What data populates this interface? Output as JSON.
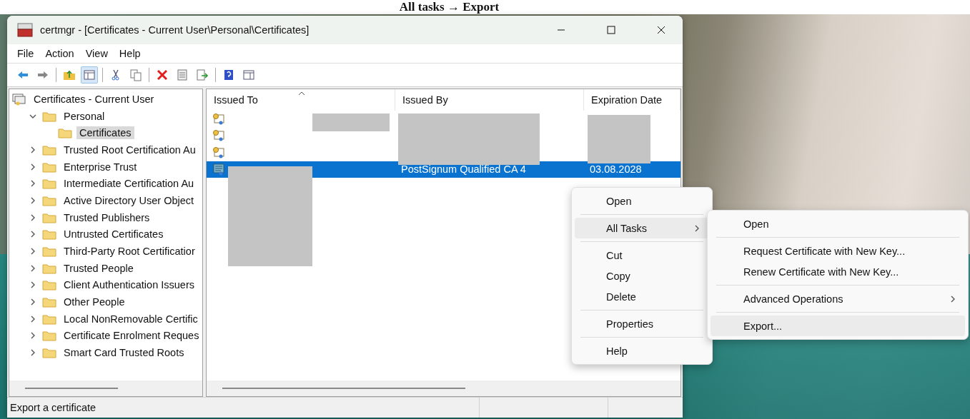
{
  "caption": "All tasks → Export",
  "window": {
    "title": "certmgr - [Certificates - Current User\\Personal\\Certificates]"
  },
  "menu_bar": [
    "File",
    "Action",
    "View",
    "Help"
  ],
  "tree": {
    "label": "Certificates - Current User",
    "selected": false,
    "children": [
      {
        "label": "Personal",
        "selected": false,
        "expanded": true,
        "children": [
          {
            "label": "Certificates",
            "selected": true
          }
        ]
      },
      {
        "label": "Trusted Root Certification Au",
        "selected": false,
        "expanded": false
      },
      {
        "label": "Enterprise Trust",
        "selected": false,
        "expanded": false
      },
      {
        "label": "Intermediate Certification Au",
        "selected": false,
        "expanded": false
      },
      {
        "label": "Active Directory User Object",
        "selected": false,
        "expanded": false
      },
      {
        "label": "Trusted Publishers",
        "selected": false,
        "expanded": false
      },
      {
        "label": "Untrusted Certificates",
        "selected": false,
        "expanded": false
      },
      {
        "label": "Third-Party Root Certificatior",
        "selected": false,
        "expanded": false
      },
      {
        "label": "Trusted People",
        "selected": false,
        "expanded": false
      },
      {
        "label": "Client Authentication Issuers",
        "selected": false,
        "expanded": false
      },
      {
        "label": "Other People",
        "selected": false,
        "expanded": false
      },
      {
        "label": "Local NonRemovable Certific",
        "selected": false,
        "expanded": false
      },
      {
        "label": "Certificate Enrolment Reques",
        "selected": false,
        "expanded": false
      },
      {
        "label": "Smart Card Trusted Roots",
        "selected": false,
        "expanded": false
      }
    ]
  },
  "table": {
    "columns": [
      {
        "label": "Issued To",
        "sorted": true
      },
      {
        "label": "Issued By",
        "sorted": false
      },
      {
        "label": "Expiration Date",
        "sorted": false
      }
    ],
    "rows": [
      {
        "kind": "certificate",
        "selected": false
      },
      {
        "kind": "certificate",
        "selected": false
      },
      {
        "kind": "certificate",
        "selected": false
      },
      {
        "kind": "qualified",
        "selected": true,
        "issued_by": "PostSignum Qualified CA 4",
        "expiration_date": "03.08.2028"
      }
    ]
  },
  "context_menu": {
    "groups": [
      [
        {
          "label": "Open",
          "selected": false
        }
      ],
      [
        {
          "label": "All Tasks",
          "selected": true,
          "submenu": true
        }
      ],
      [
        {
          "label": "Cut",
          "selected": false
        },
        {
          "label": "Copy",
          "selected": false
        },
        {
          "label": "Delete",
          "selected": false
        }
      ],
      [
        {
          "label": "Properties",
          "selected": false
        }
      ],
      [
        {
          "label": "Help",
          "selected": false
        }
      ]
    ]
  },
  "submenu": {
    "groups": [
      [
        {
          "label": "Open",
          "selected": false
        }
      ],
      [
        {
          "label": "Request Certificate with New Key...",
          "selected": false
        },
        {
          "label": "Renew Certificate with New Key...",
          "selected": false
        }
      ],
      [
        {
          "label": "Advanced Operations",
          "selected": false,
          "submenu": true
        }
      ],
      [
        {
          "label": "Export...",
          "selected": true
        }
      ]
    ]
  },
  "status_bar": {
    "text": "Export a certificate"
  }
}
